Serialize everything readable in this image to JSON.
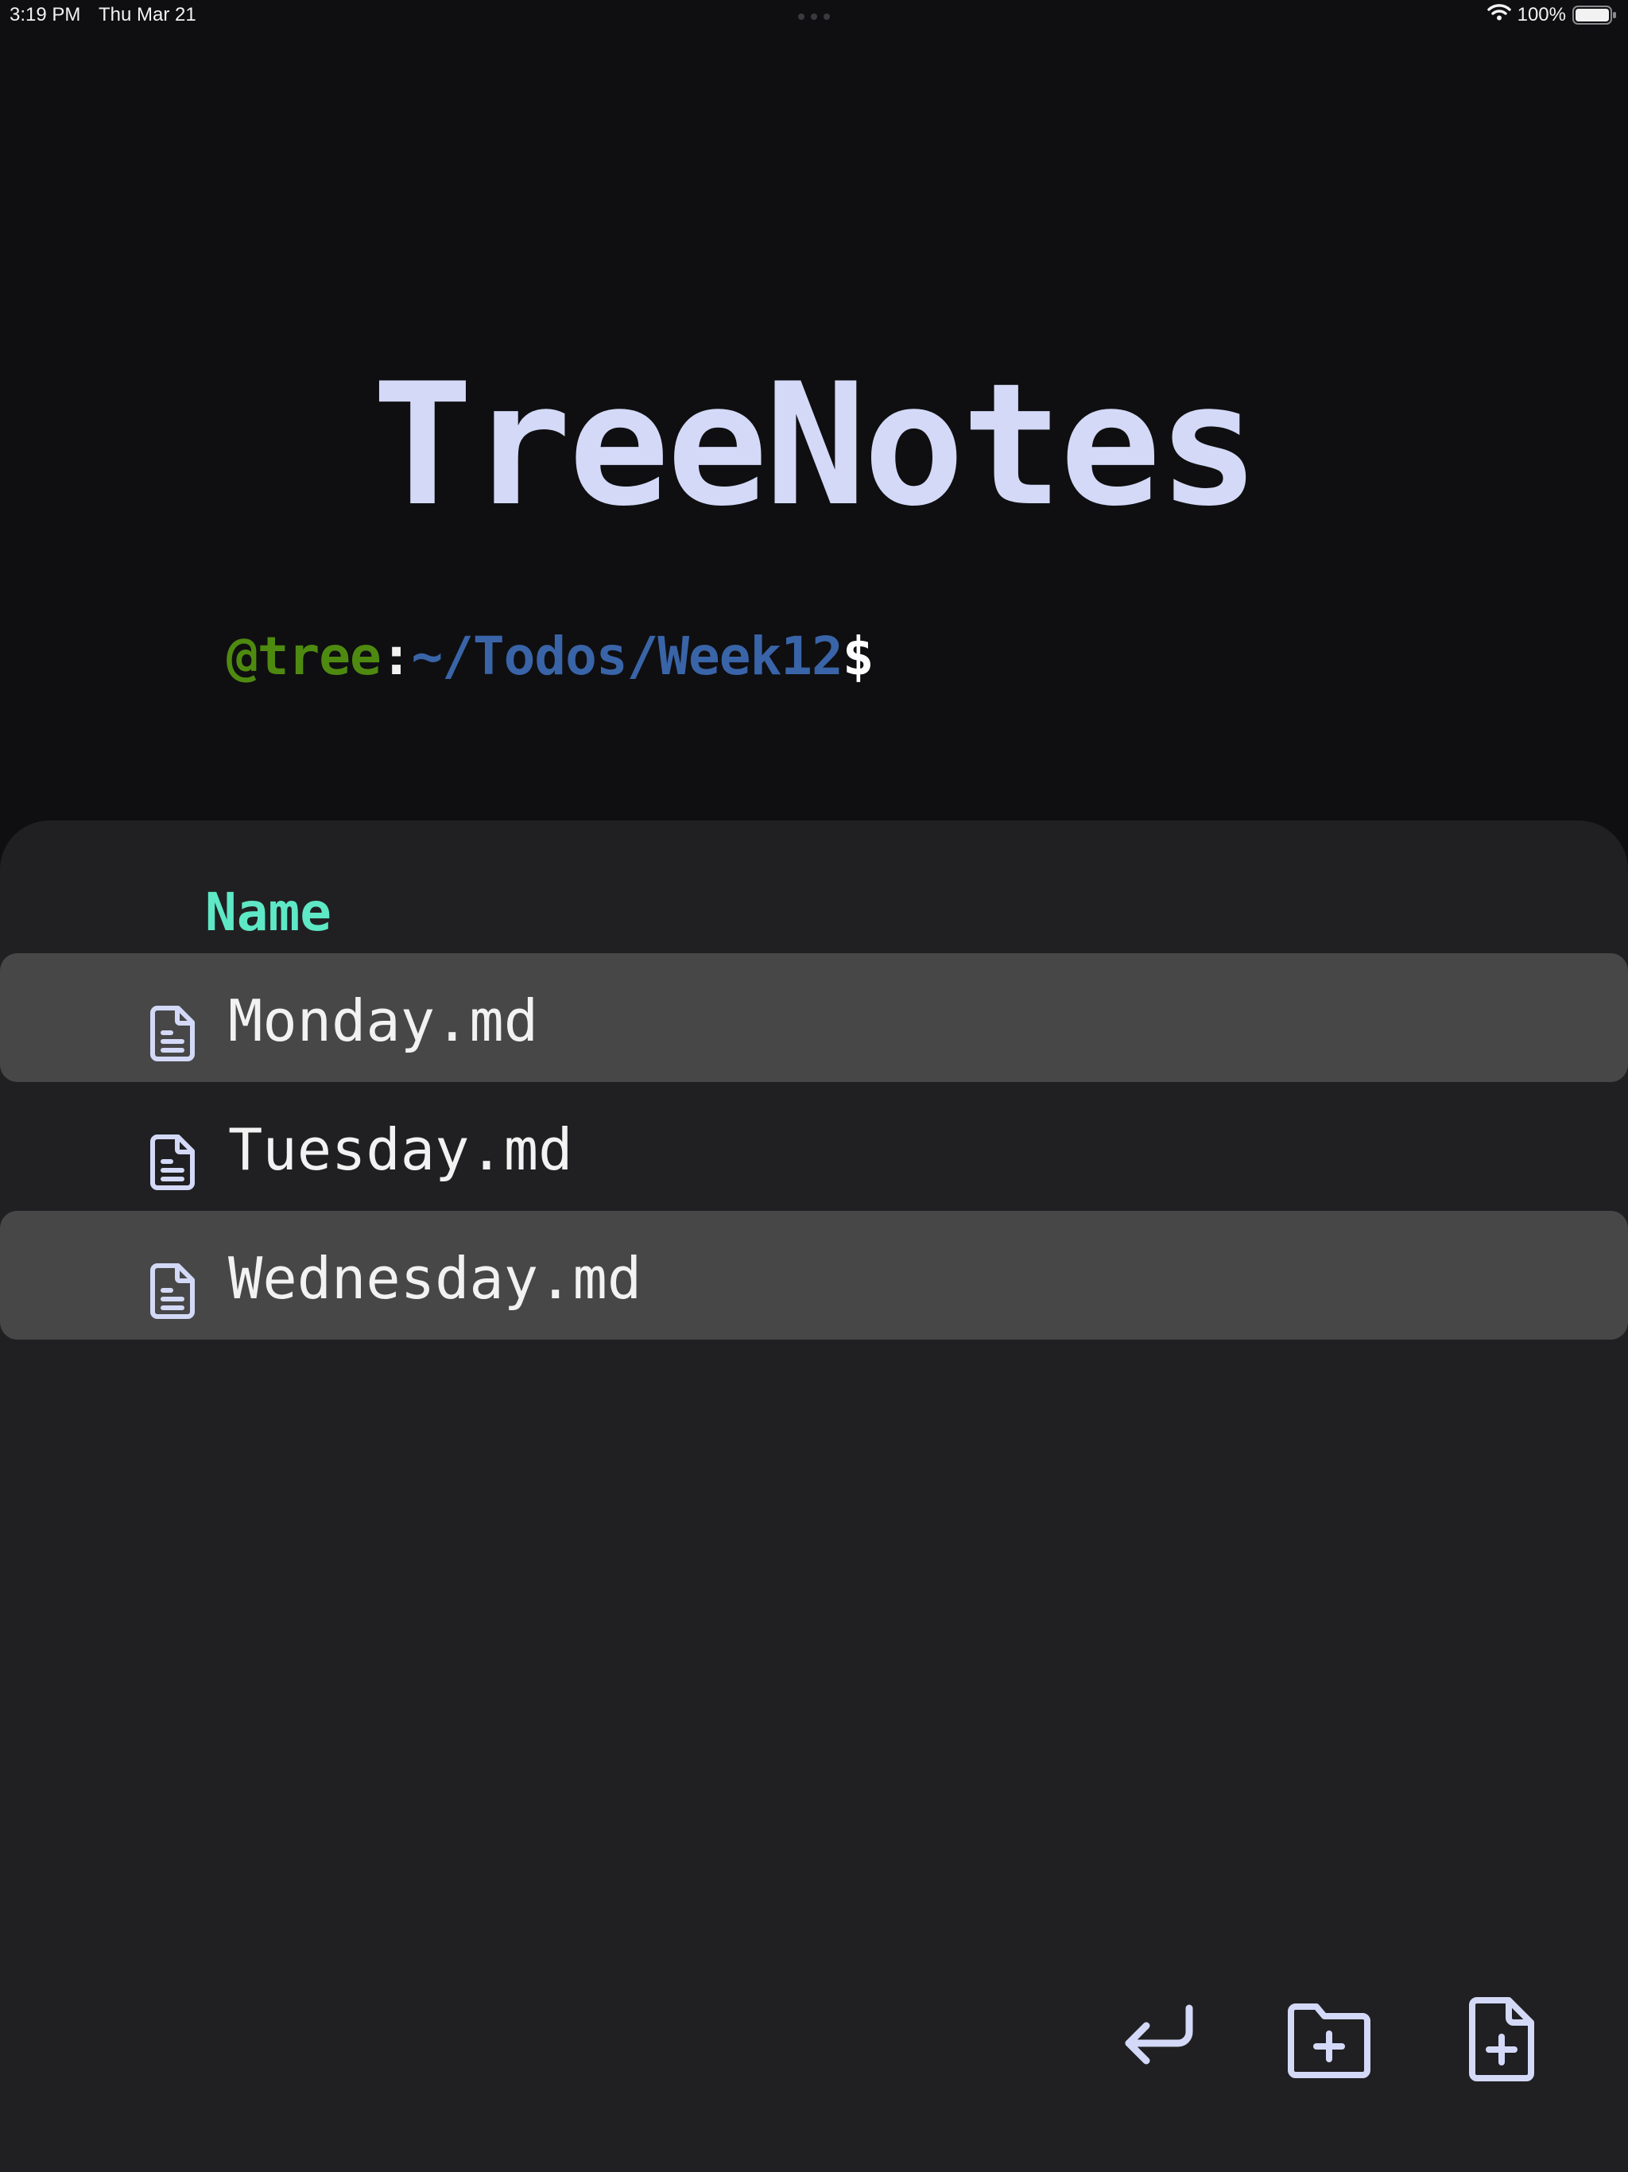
{
  "status_bar": {
    "time": "3:19 PM",
    "date": "Thu Mar 21",
    "battery_percent": "100%",
    "icons": [
      "wifi-icon",
      "battery-icon"
    ]
  },
  "app": {
    "title": "TreeNotes"
  },
  "prompt": {
    "user": "@tree",
    "separator": ":",
    "path": "~/Todos/Week12",
    "symbol": "$"
  },
  "file_list": {
    "column_header": "Name",
    "files": [
      {
        "name": "Monday.md",
        "icon": "file-text-icon",
        "highlighted": true
      },
      {
        "name": "Tuesday.md",
        "icon": "file-text-icon",
        "highlighted": false
      },
      {
        "name": "Wednesday.md",
        "icon": "file-text-icon",
        "highlighted": true
      }
    ]
  },
  "toolbar": {
    "buttons": [
      {
        "icon": "return-icon",
        "action": "go back"
      },
      {
        "icon": "folder-plus-icon",
        "action": "new folder"
      },
      {
        "icon": "file-plus-icon",
        "action": "new file"
      }
    ]
  },
  "colors": {
    "background": "#0f0f11",
    "panel": "#202022",
    "row_highlight": "#474748",
    "title": "#d3d9f7",
    "prompt_user": "#4f8a10",
    "prompt_path": "#3a64a8",
    "column_header": "#5ee8c6",
    "icon": "#d3d9f7",
    "file_text": "#f2f2f2"
  }
}
